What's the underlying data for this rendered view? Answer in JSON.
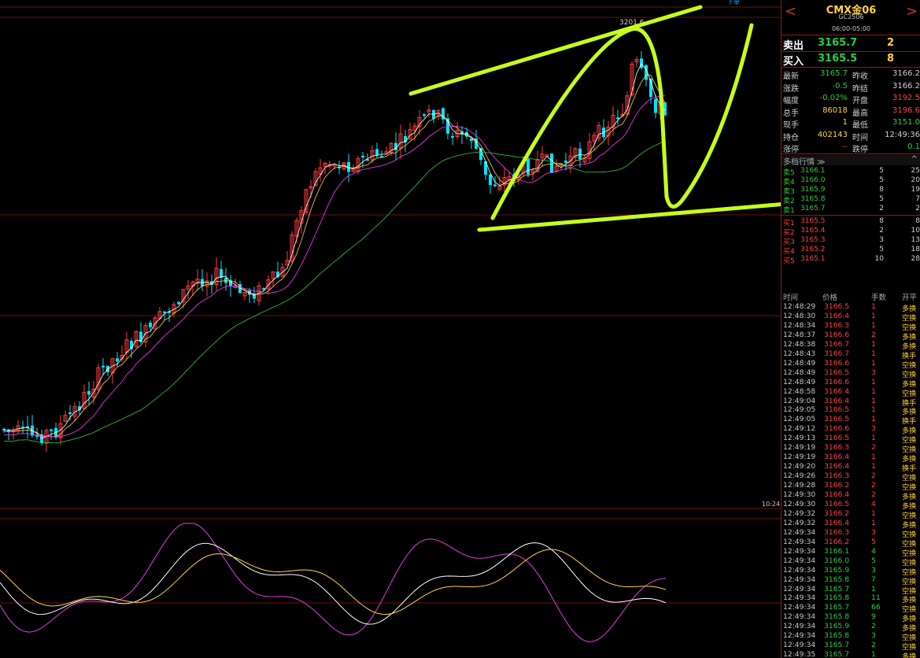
{
  "header": {
    "symbol_name": "CMX金06",
    "symbol_code": "GC2506",
    "session_hours": "06:00-05:00",
    "corner_label": "下单",
    "prev_arrow": "<",
    "next_arrow": ">"
  },
  "quote": {
    "sell_label": "卖出",
    "sell_price": "3165.7",
    "sell_qty": "2",
    "buy_label": "买入",
    "buy_price": "3165.5",
    "buy_qty": "8"
  },
  "stats": [
    {
      "l1": "最新",
      "v1": "3165.7",
      "c1": "#2ecc40",
      "l2": "昨收",
      "v2": "3166.2",
      "c2": "#d0d0d0"
    },
    {
      "l1": "涨跌",
      "v1": "-0.5",
      "c1": "#2ecc40",
      "l2": "昨结",
      "v2": "3166.2",
      "c2": "#d0d0d0"
    },
    {
      "l1": "幅度",
      "v1": "-0.02%",
      "c1": "#2ecc40",
      "l2": "开盘",
      "v2": "3192.5",
      "c2": "#ff4040"
    },
    {
      "l1": "总手",
      "v1": "86018",
      "c1": "#ffd23f",
      "l2": "最高",
      "v2": "3196.6",
      "c2": "#ff4040"
    },
    {
      "l1": "现手",
      "v1": "1",
      "c1": "#ffd23f",
      "l2": "最低",
      "v2": "3151.0",
      "c2": "#2ecc40"
    },
    {
      "l1": "持仓",
      "v1": "402143",
      "c1": "#ffd23f",
      "l2": "时间",
      "v2": "12:49:36",
      "c2": "#d0d0d0"
    },
    {
      "l1": "涨停",
      "v1": "--",
      "c1": "#ff4040",
      "l2": "跌停",
      "v2": "0.1",
      "c2": "#2ecc40"
    }
  ],
  "orderbook": {
    "title": "多档行情 ≫",
    "collapse_icon": "^",
    "asks": [
      {
        "label": "卖5",
        "price": "3166.1",
        "qty": "5",
        "extra": "25"
      },
      {
        "label": "卖4",
        "price": "3166.0",
        "qty": "5",
        "extra": "20"
      },
      {
        "label": "卖3",
        "price": "3165.9",
        "qty": "8",
        "extra": "19"
      },
      {
        "label": "卖2",
        "price": "3165.8",
        "qty": "5",
        "extra": "7"
      },
      {
        "label": "卖1",
        "price": "3165.7",
        "qty": "2",
        "extra": "2"
      }
    ],
    "bids": [
      {
        "label": "买1",
        "price": "3165.5",
        "qty": "8",
        "extra": "8"
      },
      {
        "label": "买2",
        "price": "3165.4",
        "qty": "2",
        "extra": "10"
      },
      {
        "label": "买3",
        "price": "3165.3",
        "qty": "3",
        "extra": "13"
      },
      {
        "label": "买4",
        "price": "3165.2",
        "qty": "5",
        "extra": "18"
      },
      {
        "label": "买5",
        "price": "3165.1",
        "qty": "10",
        "extra": "28"
      }
    ]
  },
  "ticks": {
    "headers": [
      "时间",
      "价格",
      "手数",
      "开平"
    ],
    "rows": [
      [
        "12:48:29",
        "3166.5",
        "1",
        "多换",
        "r"
      ],
      [
        "12:48:30",
        "3166.4",
        "1",
        "空换",
        "r"
      ],
      [
        "12:48:34",
        "3166.3",
        "1",
        "空换",
        "r"
      ],
      [
        "12:48:37",
        "3166.6",
        "2",
        "多换",
        "r"
      ],
      [
        "12:48:38",
        "3166.7",
        "1",
        "多换",
        "r"
      ],
      [
        "12:48:43",
        "3166.7",
        "1",
        "换手",
        "r"
      ],
      [
        "12:48:49",
        "3166.6",
        "1",
        "空换",
        "r"
      ],
      [
        "12:48:49",
        "3166.5",
        "3",
        "空换",
        "r"
      ],
      [
        "12:48:49",
        "3166.6",
        "1",
        "多换",
        "r"
      ],
      [
        "12:48:58",
        "3166.4",
        "1",
        "空换",
        "r"
      ],
      [
        "12:49:04",
        "3166.4",
        "1",
        "换手",
        "r"
      ],
      [
        "12:49:05",
        "3166.5",
        "1",
        "多换",
        "r"
      ],
      [
        "12:49:05",
        "3166.5",
        "1",
        "换手",
        "r"
      ],
      [
        "12:49:12",
        "3166.6",
        "3",
        "多换",
        "r"
      ],
      [
        "12:49:13",
        "3166.5",
        "1",
        "空换",
        "r"
      ],
      [
        "12:49:19",
        "3166.3",
        "2",
        "空换",
        "r"
      ],
      [
        "12:49:19",
        "3166.4",
        "1",
        "多换",
        "r"
      ],
      [
        "12:49:20",
        "3166.4",
        "1",
        "换手",
        "r"
      ],
      [
        "12:49:26",
        "3166.3",
        "2",
        "空换",
        "r"
      ],
      [
        "12:49:28",
        "3166.2",
        "2",
        "空换",
        "r"
      ],
      [
        "12:49:30",
        "3166.4",
        "2",
        "多换",
        "r"
      ],
      [
        "12:49:30",
        "3166.5",
        "4",
        "多换",
        "r"
      ],
      [
        "12:49:32",
        "3166.2",
        "1",
        "空换",
        "r"
      ],
      [
        "12:49:32",
        "3166.4",
        "1",
        "多换",
        "r"
      ],
      [
        "12:49:34",
        "3166.3",
        "3",
        "空换",
        "r"
      ],
      [
        "12:49:34",
        "3166.2",
        "5",
        "空换",
        "r"
      ],
      [
        "12:49:34",
        "3166.1",
        "4",
        "空换",
        "g"
      ],
      [
        "12:49:34",
        "3166.0",
        "5",
        "空换",
        "g"
      ],
      [
        "12:49:34",
        "3165.9",
        "3",
        "空换",
        "g"
      ],
      [
        "12:49:34",
        "3165.8",
        "7",
        "空换",
        "g"
      ],
      [
        "12:49:34",
        "3165.7",
        "1",
        "空换",
        "g"
      ],
      [
        "12:49:34",
        "3165.8",
        "11",
        "多换",
        "g"
      ],
      [
        "12:49:34",
        "3165.7",
        "66",
        "空换",
        "g"
      ],
      [
        "12:49:34",
        "3165.8",
        "9",
        "多换",
        "g"
      ],
      [
        "12:49:34",
        "3165.9",
        "2",
        "多换",
        "g"
      ],
      [
        "12:49:34",
        "3165.8",
        "3",
        "空换",
        "g"
      ],
      [
        "12:49:34",
        "3165.7",
        "2",
        "空换",
        "g"
      ],
      [
        "12:49:35",
        "3165.7",
        "1",
        "多换",
        "g"
      ],
      [
        "12:49:35",
        "3165.9",
        "2",
        "多换",
        "g"
      ],
      [
        "12:49:35",
        "3166.0",
        "5",
        "多换",
        "g"
      ]
    ]
  },
  "chart": {
    "peak_label": "3201.6",
    "time_axis_label": "10:24",
    "up_color": "#ff3b3b",
    "down_color": "#00e5ff",
    "ma_colors": [
      "#ffffff",
      "#ffd23f",
      "#ff3bff",
      "#2ecc40"
    ],
    "annotation_color": "#c6ff1a"
  }
}
